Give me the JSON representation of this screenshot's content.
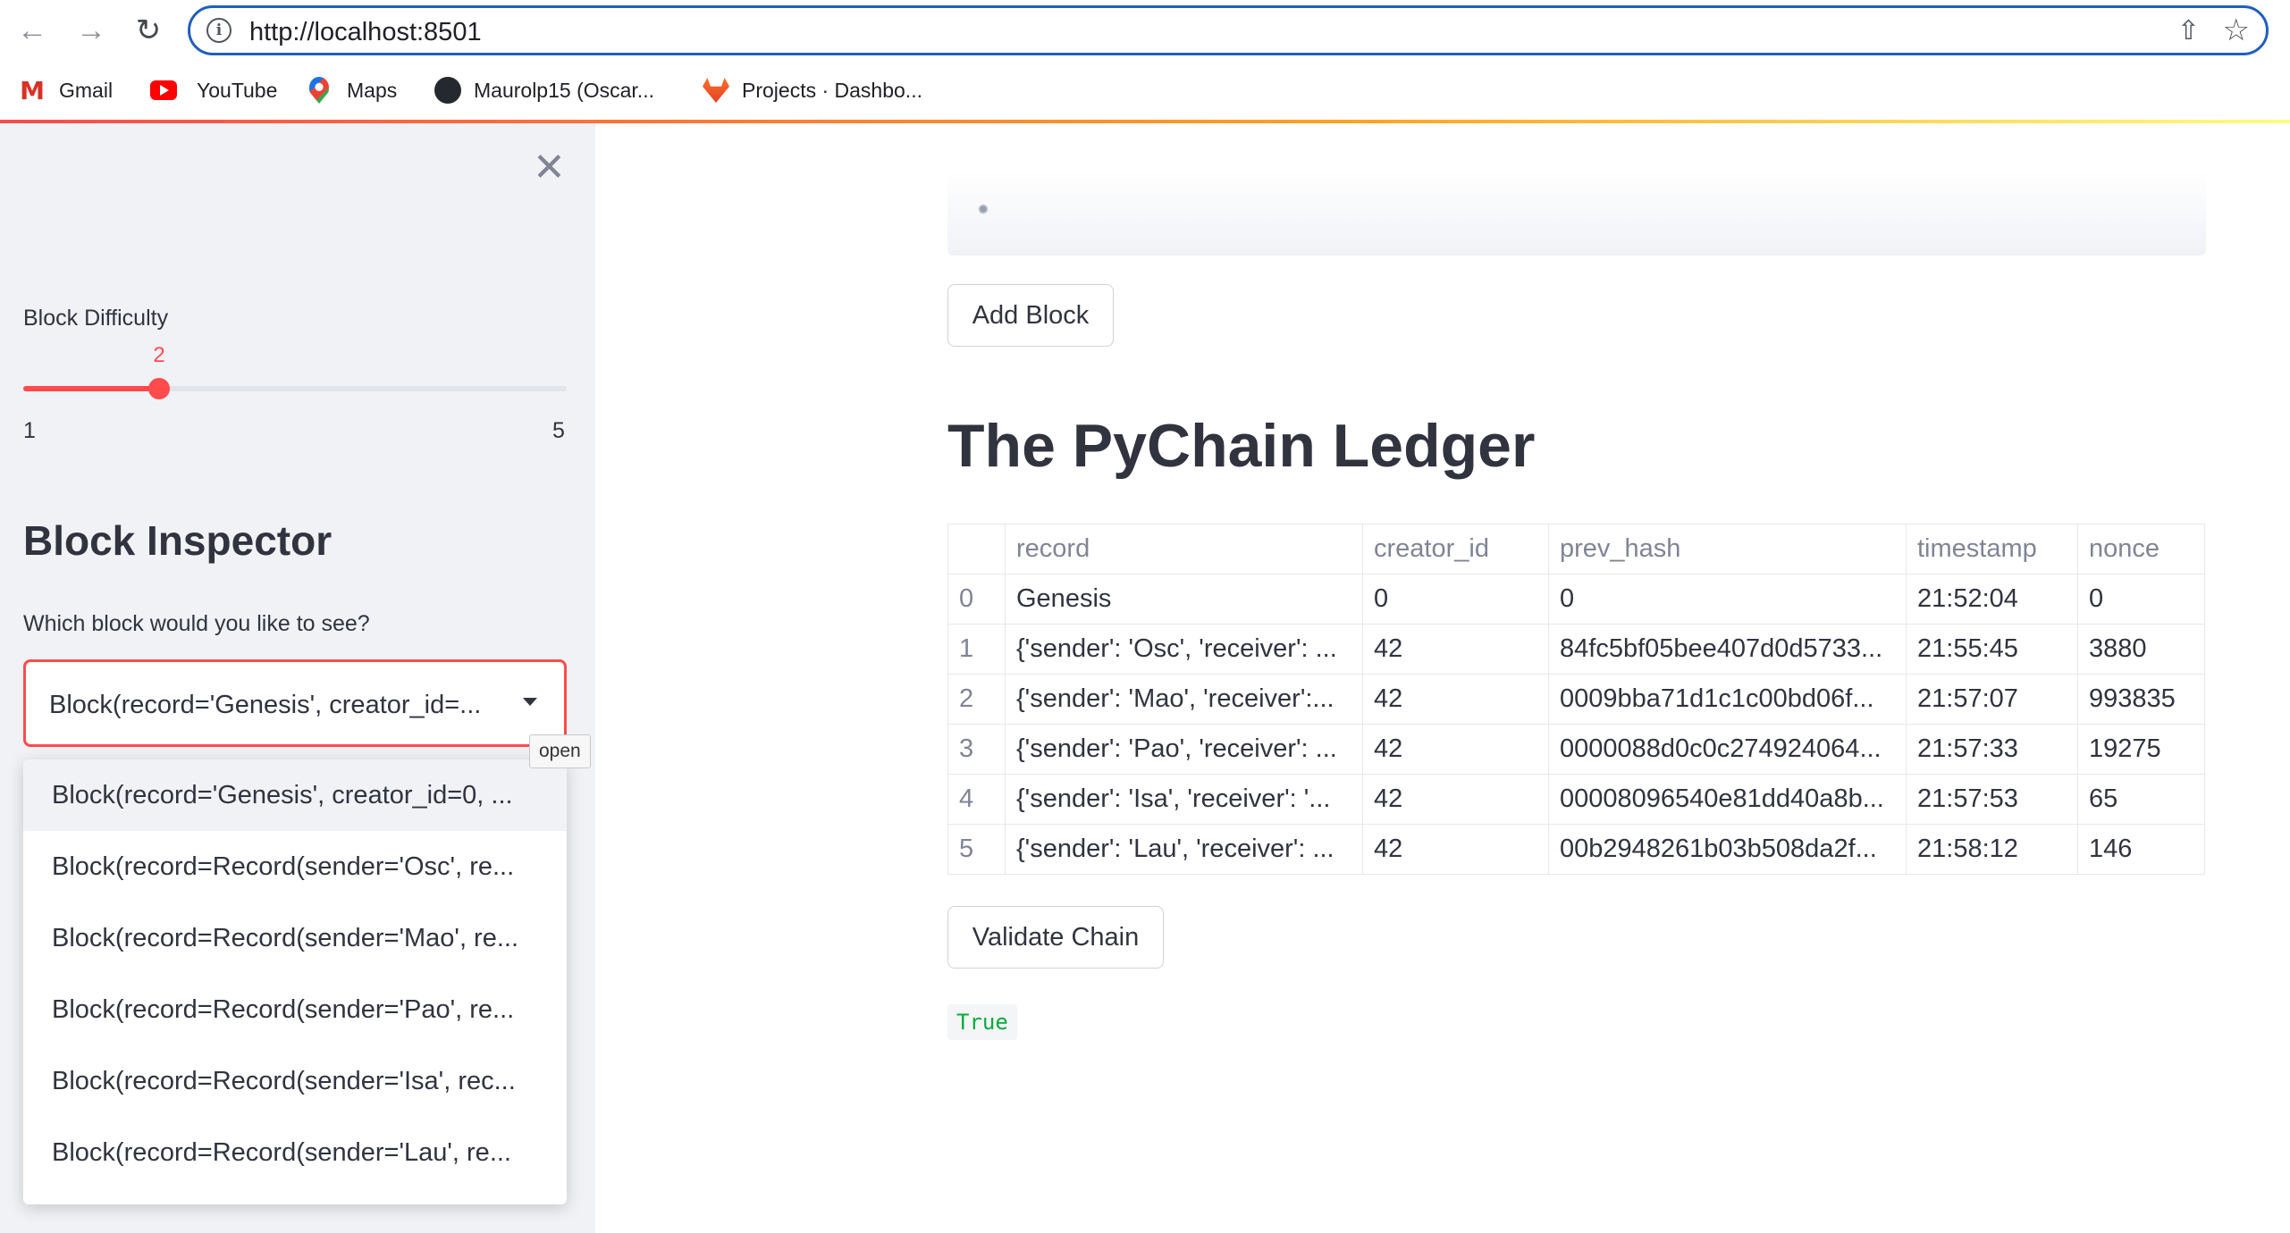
{
  "browser": {
    "url": "http://localhost:8501",
    "bookmarks": [
      {
        "label": "Gmail",
        "icon": "gmail-icon"
      },
      {
        "label": "YouTube",
        "icon": "youtube-icon"
      },
      {
        "label": "Maps",
        "icon": "maps-icon"
      },
      {
        "label": "Maurolp15 (Oscar...",
        "icon": "github-icon"
      },
      {
        "label": "Projects · Dashbo...",
        "icon": "gitlab-icon"
      }
    ]
  },
  "sidebar": {
    "slider": {
      "label": "Block Difficulty",
      "value": 2,
      "min": 1,
      "max": 5,
      "min_label": "1",
      "max_label": "5",
      "value_label": "2"
    },
    "heading": "Block Inspector",
    "select": {
      "label": "Which block would you like to see?",
      "value": "Block(record='Genesis', creator_id=...",
      "tooltip": "open",
      "options": [
        "Block(record='Genesis', creator_id=0, ...",
        "Block(record=Record(sender='Osc', re...",
        "Block(record=Record(sender='Mao', re...",
        "Block(record=Record(sender='Pao', re...",
        "Block(record=Record(sender='Isa', rec...",
        "Block(record=Record(sender='Lau', re..."
      ]
    }
  },
  "main": {
    "add_block_label": "Add Block",
    "title": "The PyChain Ledger",
    "table": {
      "columns": [
        "",
        "record",
        "creator_id",
        "prev_hash",
        "timestamp",
        "nonce"
      ],
      "rows": [
        [
          "0",
          "Genesis",
          "0",
          "0",
          "21:52:04",
          "0"
        ],
        [
          "1",
          "{'sender': 'Osc', 'receiver': ...",
          "42",
          "84fc5bf05bee407d0d5733...",
          "21:55:45",
          "3880"
        ],
        [
          "2",
          "{'sender': 'Mao', 'receiver':...",
          "42",
          "0009bba71d1c1c00bd06f...",
          "21:57:07",
          "993835"
        ],
        [
          "3",
          "{'sender': 'Pao', 'receiver': ...",
          "42",
          "0000088d0c0c274924064...",
          "21:57:33",
          "19275"
        ],
        [
          "4",
          "{'sender': 'Isa', 'receiver': '...",
          "42",
          "00008096540e81dd40a8b...",
          "21:57:53",
          "65"
        ],
        [
          "5",
          "{'sender': 'Lau', 'receiver': ...",
          "42",
          "00b2948261b03b508da2f...",
          "21:58:12",
          "146"
        ]
      ]
    },
    "validate_label": "Validate Chain",
    "validate_result": "True"
  },
  "colors": {
    "accent": "#ff4b4b",
    "sidebar_bg": "#f0f2f6",
    "text": "#31333f",
    "success": "#09ab3b",
    "url_border": "#1f5fbf"
  }
}
